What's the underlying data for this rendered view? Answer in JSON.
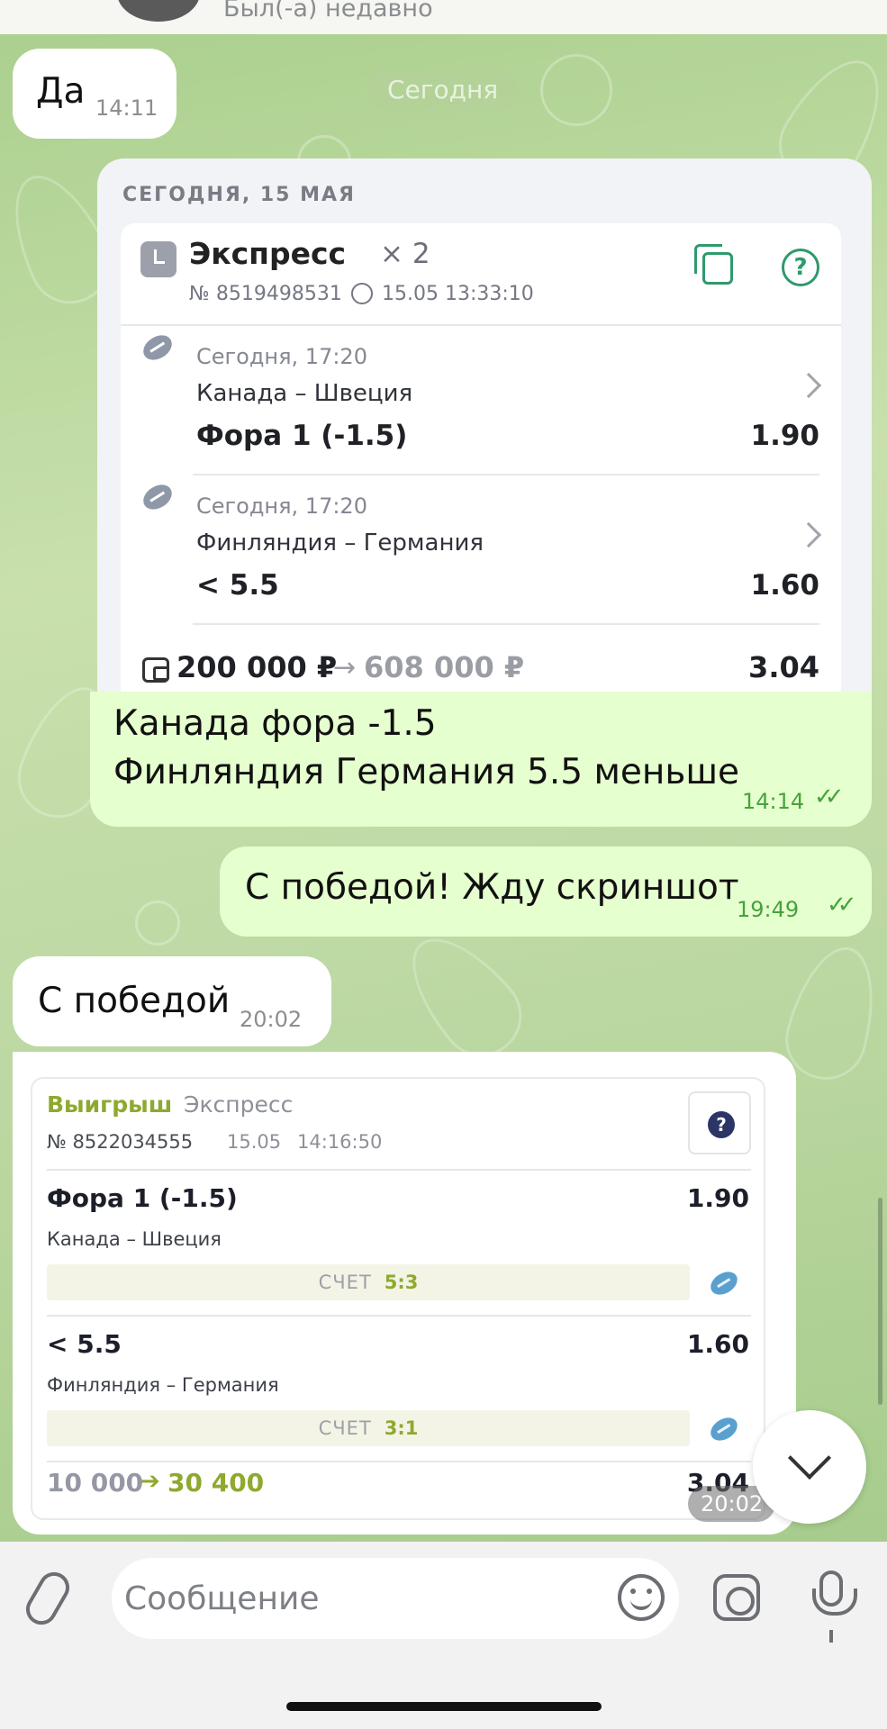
{
  "header": {
    "status": "Был(-а) недавно"
  },
  "date_pill": "Сегодня",
  "messages": {
    "m1": {
      "text": "Да",
      "time": "14:11"
    },
    "m2": {
      "line1": "Канада фора -1.5",
      "line2": "Финляндия Германия 5.5 меньше",
      "time": "14:14"
    },
    "m3": {
      "text": "С победой! Жду скриншот",
      "time": "19:49"
    },
    "m4": {
      "text": "С победой",
      "time": "20:02"
    },
    "m5": {
      "time": "20:02"
    }
  },
  "bet_card": {
    "date": "СЕГОДНЯ, 15 МАЯ",
    "title": "Экспресс",
    "multiplier": "× 2",
    "number": "№ 8519498531",
    "datetime": "15.05 13:33:10",
    "events": [
      {
        "date": "Сегодня, 17:20",
        "match": "Канада – Швеция",
        "bet": "Фора 1 (-1.5)",
        "odd": "1.90"
      },
      {
        "date": "Сегодня, 17:20",
        "match": "Финляндия – Германия",
        "bet": "< 5.5",
        "odd": "1.60"
      }
    ],
    "stake": "200 000 ₽",
    "arrow": "→",
    "payout": "608 000 ₽",
    "total_odd": "3.04"
  },
  "win_card": {
    "label": "Выигрыш",
    "type": "Экспресс",
    "number": "№ 8522034555",
    "date": "15.05",
    "time": "14:16:50",
    "help": "?",
    "events": [
      {
        "bet": "Фора 1 (-1.5)",
        "odd": "1.90",
        "match": "Канада – Швеция",
        "score_label": "СЧЕТ",
        "score": "5:3"
      },
      {
        "bet": "< 5.5",
        "odd": "1.60",
        "match": "Финляндия – Германия",
        "score_label": "СЧЕТ",
        "score": "3:1"
      }
    ],
    "stake": "10 000",
    "arrow": "➔",
    "payout": "30 400",
    "total_odd": "3.04"
  },
  "input": {
    "placeholder": "Сообщение"
  },
  "ticks": "✓✓",
  "help_symbol": "?",
  "colors": {
    "outgoing_bubble": "#e6ffcf",
    "incoming_bubble": "#ffffff",
    "accent_green": "#46a33b",
    "win_green": "#8ea92f"
  }
}
